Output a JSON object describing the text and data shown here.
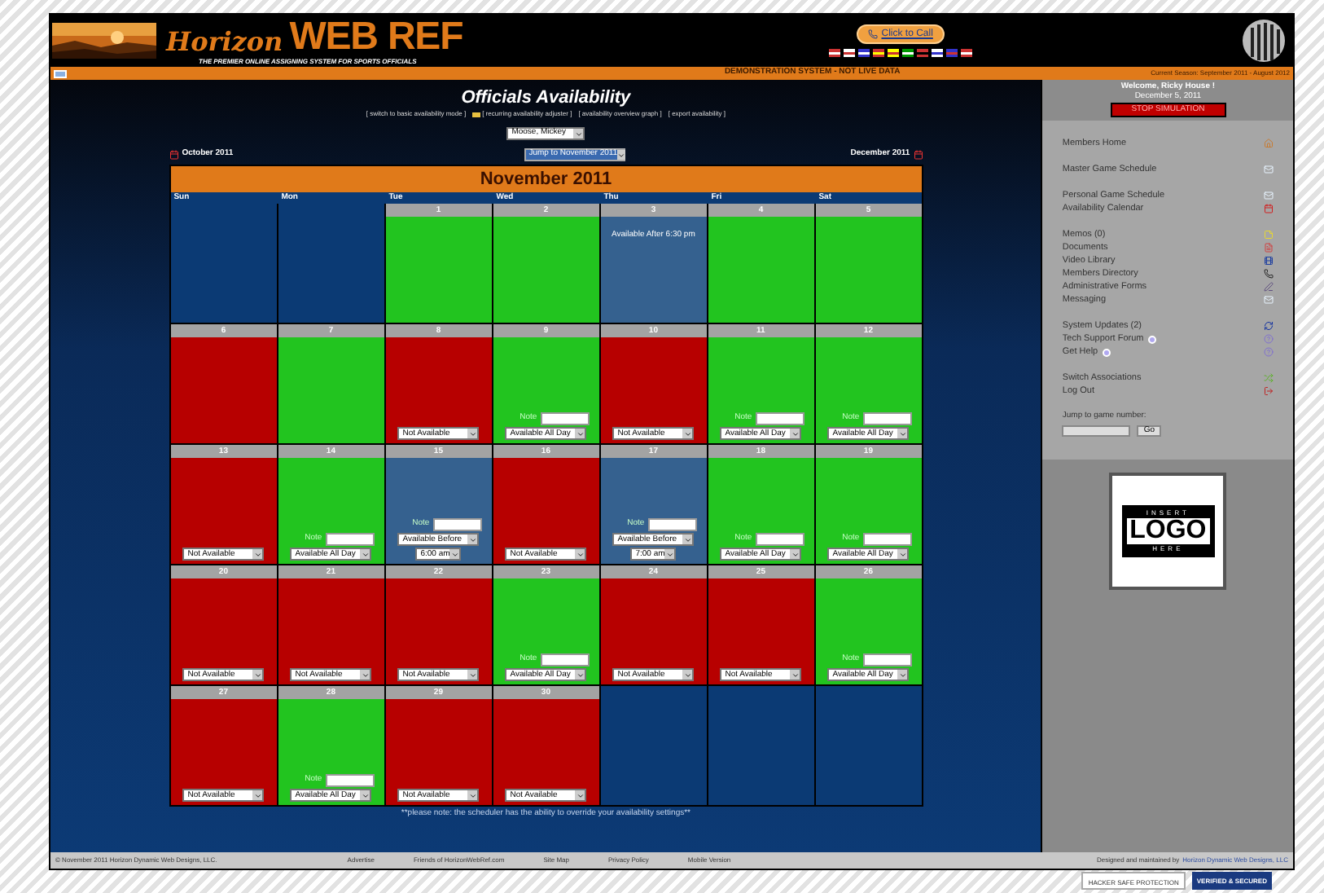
{
  "header": {
    "brand_script": "Horizon",
    "brand": "WEB REF",
    "tagline": "THE PREMIER ONLINE ASSIGNING SYSTEM FOR SPORTS OFFICIALS",
    "call_button": "Click to Call"
  },
  "notice_bar": {
    "message": "DEMONSTRATION SYSTEM - NOT LIVE DATA",
    "season": "Current Season: September 2011 - August 2012"
  },
  "page": {
    "title": "Officials Availability",
    "links": [
      {
        "label": "[ switch to basic availability mode ]",
        "kind": "plain"
      },
      {
        "label": "[ recurring availability adjuster ]",
        "kind": "iconed"
      },
      {
        "label": "[ availability overview graph ]",
        "kind": "plain"
      },
      {
        "label": "[ export availability ]",
        "kind": "plain"
      }
    ],
    "official_select": "Moose, Mickey",
    "prev_month": "October 2011",
    "jump_select": "Jump to November 2011",
    "next_month": "December 2011",
    "footnote": "**please note: the scheduler has the ability to override your availability settings**"
  },
  "calendar": {
    "month": "November 2011",
    "weekdays": [
      "Sun",
      "Mon",
      "Tue",
      "Wed",
      "Thu",
      "Fri",
      "Sat"
    ],
    "days": [
      {
        "kind": "blank"
      },
      {
        "kind": "blank"
      },
      {
        "day": "1",
        "kind": "available"
      },
      {
        "day": "2",
        "kind": "available"
      },
      {
        "day": "3",
        "kind": "partial",
        "message": "Available After 6:30 pm"
      },
      {
        "day": "4",
        "kind": "available"
      },
      {
        "day": "5",
        "kind": "available"
      },
      {
        "day": "6",
        "kind": "unavailable"
      },
      {
        "day": "7",
        "kind": "available"
      },
      {
        "day": "8",
        "kind": "unavailable",
        "availability": "Not Available"
      },
      {
        "day": "9",
        "kind": "available",
        "note_label": "Note",
        "availability": "Available All Day"
      },
      {
        "day": "10",
        "kind": "unavailable",
        "availability": "Not Available"
      },
      {
        "day": "11",
        "kind": "available",
        "note_label": "Note",
        "availability": "Available All Day"
      },
      {
        "day": "12",
        "kind": "available",
        "note_label": "Note",
        "availability": "Available All Day"
      },
      {
        "day": "13",
        "kind": "unavailable",
        "availability": "Not Available"
      },
      {
        "day": "14",
        "kind": "available",
        "note_label": "Note",
        "availability": "Available All Day"
      },
      {
        "day": "15",
        "kind": "partial",
        "note_label": "Note",
        "availability": "Available Before",
        "time": "6:00 am"
      },
      {
        "day": "16",
        "kind": "unavailable",
        "availability": "Not Available"
      },
      {
        "day": "17",
        "kind": "partial",
        "note_label": "Note",
        "availability": "Available Before",
        "time": "7:00 am"
      },
      {
        "day": "18",
        "kind": "available",
        "note_label": "Note",
        "availability": "Available All Day"
      },
      {
        "day": "19",
        "kind": "available",
        "note_label": "Note",
        "availability": "Available All Day"
      },
      {
        "day": "20",
        "kind": "unavailable",
        "availability": "Not Available"
      },
      {
        "day": "21",
        "kind": "unavailable",
        "availability": "Not Available"
      },
      {
        "day": "22",
        "kind": "unavailable",
        "availability": "Not Available"
      },
      {
        "day": "23",
        "kind": "available",
        "note_label": "Note",
        "availability": "Available All Day"
      },
      {
        "day": "24",
        "kind": "unavailable",
        "availability": "Not Available"
      },
      {
        "day": "25",
        "kind": "unavailable",
        "availability": "Not Available"
      },
      {
        "day": "26",
        "kind": "available",
        "note_label": "Note",
        "availability": "Available All Day"
      },
      {
        "day": "27",
        "kind": "unavailable",
        "availability": "Not Available"
      },
      {
        "day": "28",
        "kind": "available",
        "note_label": "Note",
        "availability": "Available All Day"
      },
      {
        "day": "29",
        "kind": "unavailable",
        "availability": "Not Available"
      },
      {
        "day": "30",
        "kind": "unavailable",
        "availability": "Not Available"
      },
      {
        "kind": "blank"
      },
      {
        "kind": "blank"
      },
      {
        "kind": "blank"
      }
    ]
  },
  "sidebar": {
    "welcome": "Welcome, Ricky House !",
    "date": "December 5, 2011",
    "stop_button": "STOP SIMULATION",
    "groups": [
      [
        {
          "label": "Members Home",
          "kind": "home"
        }
      ],
      [
        {
          "label": "Master Game Schedule",
          "kind": "mail"
        }
      ],
      [
        {
          "label": "Personal Game Schedule",
          "kind": "mail"
        },
        {
          "label": "Availability Calendar",
          "kind": "calendar"
        }
      ],
      [
        {
          "label": "Memos (0)",
          "kind": "note"
        },
        {
          "label": "Documents",
          "kind": "doc"
        },
        {
          "label": "Video Library",
          "kind": "video"
        },
        {
          "label": "Members Directory",
          "kind": "phone"
        },
        {
          "label": "Administrative Forms",
          "kind": "form"
        },
        {
          "label": "Messaging",
          "kind": "mail"
        }
      ],
      [
        {
          "label": "System Updates (2)",
          "kind": "update"
        },
        {
          "label": "Tech Support Forum",
          "kind": "help",
          "badge": true
        },
        {
          "label": "Get Help",
          "kind": "help",
          "badge": true
        }
      ],
      [
        {
          "label": "Switch Associations",
          "kind": "switch"
        },
        {
          "label": "Log Out",
          "kind": "logout"
        }
      ]
    ],
    "jump_label": "Jump to game number:",
    "go_button": "Go",
    "logo": {
      "top": "INSERT",
      "main": "LOGO",
      "bottom": "HERE"
    }
  },
  "footer": {
    "copyright": "© November 2011 Horizon Dynamic Web Designs, LLC.",
    "links": [
      "Advertise",
      "Friends of HorizonWebRef.com",
      "Site Map",
      "Privacy Policy",
      "Mobile Version"
    ],
    "credit": "Designed and maintained by",
    "credit_link": "Horizon Dynamic Web Designs, LLC"
  },
  "badges": [
    "HACKER SAFE PROTECTION",
    "VERIFIED & SECURED"
  ]
}
